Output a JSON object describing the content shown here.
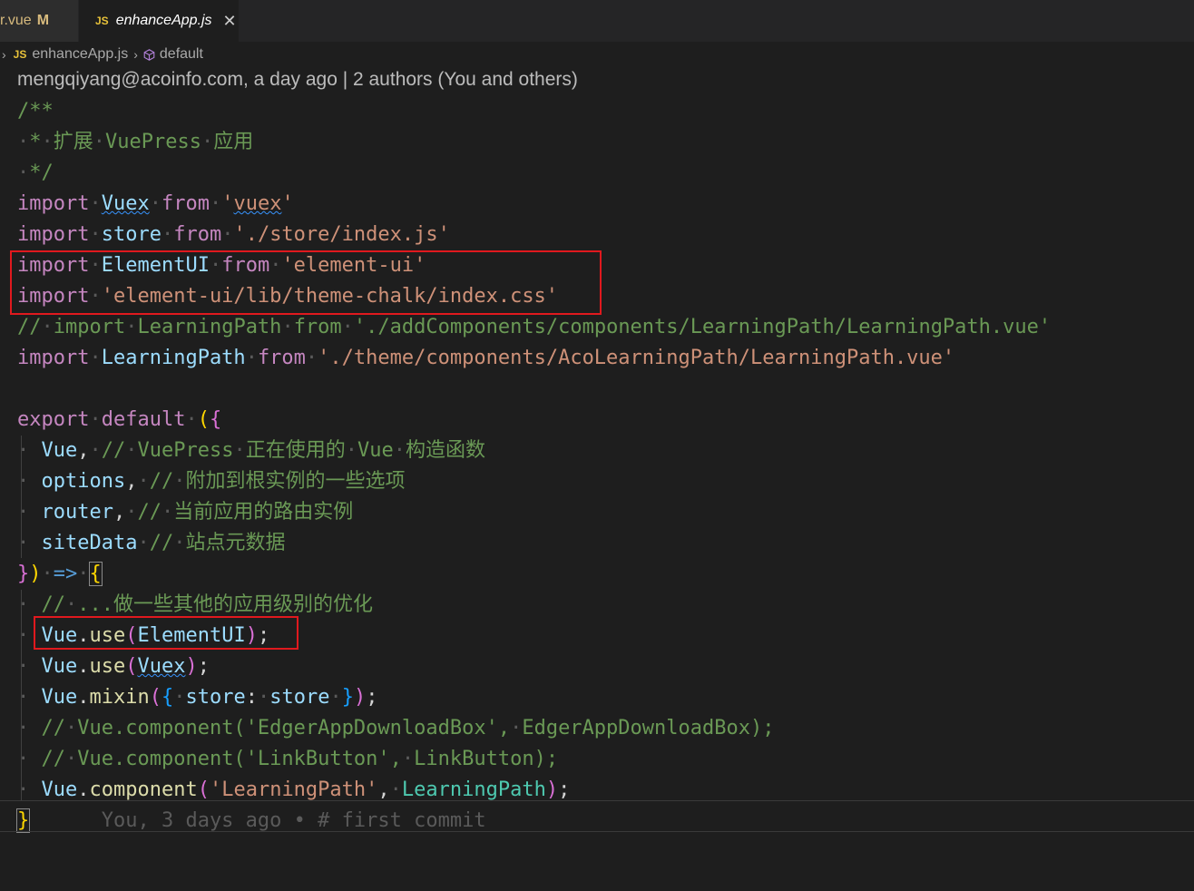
{
  "tabs": [
    {
      "label": "r.vue",
      "badge": "M"
    },
    {
      "label": "enhanceApp.js",
      "lang": "JS",
      "close": "✕"
    }
  ],
  "breadcrumb": {
    "file_lang": "JS",
    "file": "enhanceApp.js",
    "symbol": "default"
  },
  "blame_header": "mengqiyang@acoinfo.com, a day ago | 2 authors (You and others)",
  "inline_blame": "You, 3 days ago • # first commit",
  "code_lines": [
    "/**",
    " * 扩展 VuePress 应用",
    " */",
    "import Vuex from 'vuex'",
    "import store from './store/index.js'",
    "import ElementUI from 'element-ui'",
    "import 'element-ui/lib/theme-chalk/index.css'",
    "// import LearningPath from './addComponents/components/LearningPath/LearningPath.vue'",
    "import LearningPath from './theme/components/AcoLearningPath/LearningPath.vue'",
    "",
    "export default ({",
    "  Vue, // VuePress 正在使用的 Vue 构造函数",
    "  options, // 附加到根实例的一些选项",
    "  router, // 当前应用的路由实例",
    "  siteData // 站点元数据",
    "}) => {",
    "  // ...做一些其他的应用级别的优化",
    "  Vue.use(ElementUI);",
    "  Vue.use(Vuex);",
    "  Vue.mixin({ store: store });",
    "  // Vue.component('EdgerAppDownloadBox', EdgerAppDownloadBox);",
    "  // Vue.component('LinkButton', LinkButton);",
    "  Vue.component('LearningPath', LearningPath);",
    "}"
  ],
  "colors": {
    "keyword": "#c586c0",
    "identifier": "#9cdcfe",
    "string": "#ce9178",
    "comment": "#6a9955",
    "function": "#dcdcaa",
    "highlight_box": "#e0191e"
  }
}
